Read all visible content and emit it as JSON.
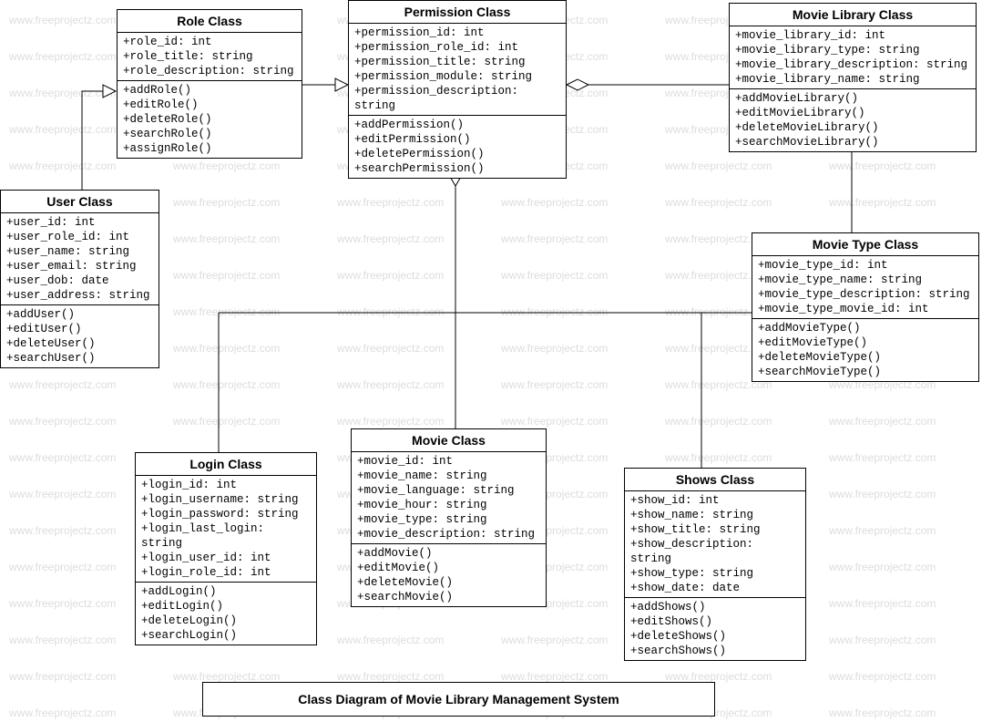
{
  "watermark_text": "www.freeprojectz.com",
  "caption": "Class Diagram of Movie Library Management System",
  "classes": {
    "role": {
      "title": "Role Class",
      "attrs": [
        "+role_id: int",
        "+role_title: string",
        "+role_description: string"
      ],
      "ops": [
        "+addRole()",
        "+editRole()",
        "+deleteRole()",
        "+searchRole()",
        "+assignRole()"
      ]
    },
    "permission": {
      "title": "Permission Class",
      "attrs": [
        "+permission_id: int",
        "+permission_role_id: int",
        "+permission_title: string",
        "+permission_module: string",
        "+permission_description: string"
      ],
      "ops": [
        "+addPermission()",
        "+editPermission()",
        "+deletePermission()",
        "+searchPermission()"
      ]
    },
    "movielibrary": {
      "title": "Movie Library Class",
      "attrs": [
        "+movie_library_id: int",
        "+movie_library_type: string",
        "+movie_library_description: string",
        "+movie_library_name: string"
      ],
      "ops": [
        "+addMovieLibrary()",
        "+editMovieLibrary()",
        "+deleteMovieLibrary()",
        "+searchMovieLibrary()"
      ]
    },
    "user": {
      "title": "User Class",
      "attrs": [
        "+user_id: int",
        "+user_role_id: int",
        "+user_name: string",
        "+user_email: string",
        "+user_dob: date",
        "+user_address: string"
      ],
      "ops": [
        "+addUser()",
        "+editUser()",
        "+deleteUser()",
        "+searchUser()"
      ]
    },
    "movietype": {
      "title": "Movie Type Class",
      "attrs": [
        "+movie_type_id: int",
        "+movie_type_name: string",
        "+movie_type_description: string",
        "+movie_type_movie_id: int"
      ],
      "ops": [
        "+addMovieType()",
        "+editMovieType()",
        "+deleteMovieType()",
        "+searchMovieType()"
      ]
    },
    "login": {
      "title": "Login Class",
      "attrs": [
        "+login_id: int",
        "+login_username: string",
        "+login_password: string",
        "+login_last_login: string",
        "+login_user_id: int",
        "+login_role_id: int"
      ],
      "ops": [
        "+addLogin()",
        "+editLogin()",
        "+deleteLogin()",
        "+searchLogin()"
      ]
    },
    "movie": {
      "title": "Movie  Class",
      "attrs": [
        "+movie_id: int",
        "+movie_name: string",
        "+movie_language: string",
        "+movie_hour: string",
        "+movie_type: string",
        "+movie_description: string"
      ],
      "ops": [
        "+addMovie()",
        "+editMovie()",
        "+deleteMovie()",
        "+searchMovie()"
      ]
    },
    "shows": {
      "title": "Shows Class",
      "attrs": [
        "+show_id: int",
        "+show_name: string",
        "+show_title: string",
        "+show_description: string",
        "+show_type: string",
        "+show_date: date"
      ],
      "ops": [
        "+addShows()",
        "+editShows()",
        "+deleteShows()",
        "+searchShows()"
      ]
    }
  }
}
